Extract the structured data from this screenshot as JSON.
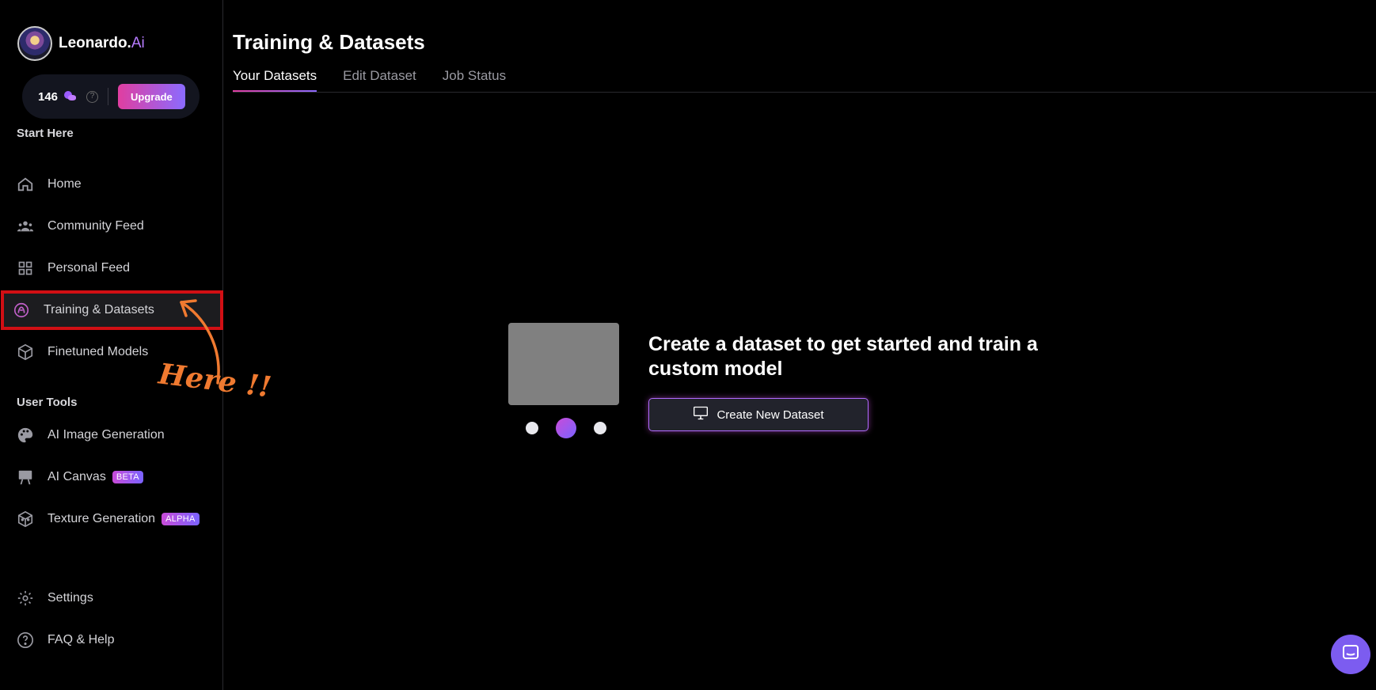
{
  "app": {
    "logo_name": "Leonardo.",
    "logo_suffix": "Ai"
  },
  "credits": {
    "count": "146",
    "upgrade_label": "Upgrade",
    "help_glyph": "?"
  },
  "sidebar": {
    "start_section": "Start Here",
    "start_items": [
      {
        "label": "Home",
        "icon": "home-icon"
      },
      {
        "label": "Community Feed",
        "icon": "community-icon"
      },
      {
        "label": "Personal Feed",
        "icon": "grid-icon"
      },
      {
        "label": "Training & Datasets",
        "icon": "training-icon",
        "active": true
      },
      {
        "label": "Finetuned Models",
        "icon": "cube-icon"
      }
    ],
    "tools_section": "User Tools",
    "tool_items": [
      {
        "label": "AI Image Generation",
        "icon": "palette-icon"
      },
      {
        "label": "AI Canvas",
        "icon": "easel-icon",
        "badge": "BETA"
      },
      {
        "label": "Texture Generation",
        "icon": "dice-icon",
        "badge": "ALPHA"
      }
    ],
    "bottom_items": [
      {
        "label": "Settings",
        "icon": "gear-icon"
      },
      {
        "label": "FAQ & Help",
        "icon": "help-icon"
      }
    ]
  },
  "annotation": {
    "text": "Here !!"
  },
  "main": {
    "title": "Training & Datasets",
    "tabs": [
      {
        "label": "Your Datasets",
        "active": true
      },
      {
        "label": "Edit Dataset"
      },
      {
        "label": "Job Status"
      }
    ],
    "empty_state": {
      "headline": "Create a dataset to get started and train a custom model",
      "button_label": "Create New Dataset"
    }
  },
  "colors": {
    "accent_pink": "#e03ea0",
    "accent_purple": "#8b6bff",
    "highlight_red": "#d10f14",
    "annotation_orange": "#f07a30"
  }
}
